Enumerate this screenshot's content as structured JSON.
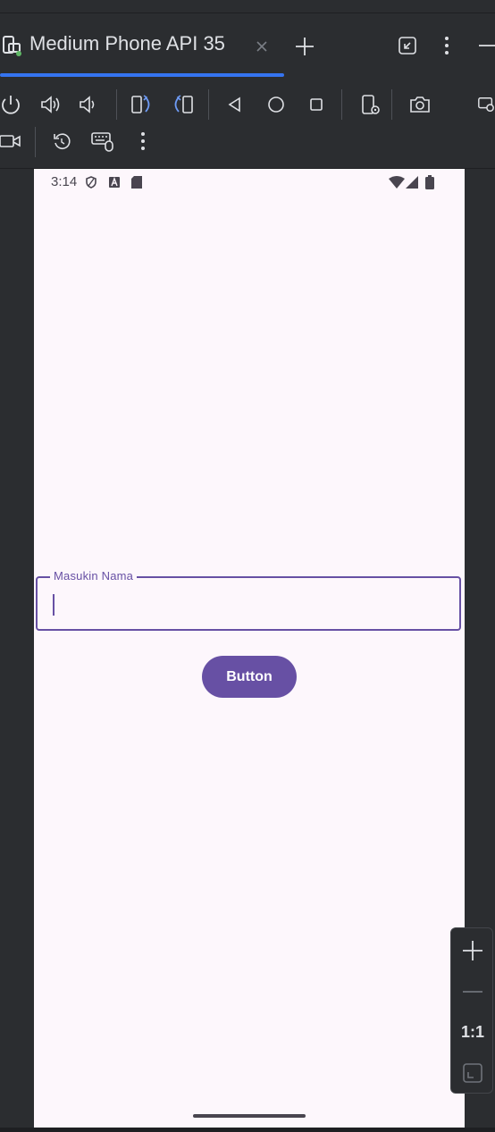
{
  "window": {
    "tab_title": "Medium Phone API 35"
  },
  "toolbar": {
    "icons": [
      "power-icon",
      "volume-up-icon",
      "volume-down-icon",
      "rotate-left-icon",
      "rotate-right-icon",
      "back-icon",
      "home-icon",
      "overview-icon",
      "device-settings-icon",
      "camera-icon",
      "mirror-icon",
      "record-icon",
      "reset-icon",
      "keyboard-mouse-icon",
      "more-icon"
    ]
  },
  "device": {
    "status_time": "3:14",
    "input": {
      "label": "Masukin Nama",
      "value": ""
    },
    "button_label": "Button",
    "colors": {
      "primary": "#6750a4",
      "surface": "#fdf7fc"
    }
  },
  "zoom": {
    "reset_label": "1:1"
  }
}
